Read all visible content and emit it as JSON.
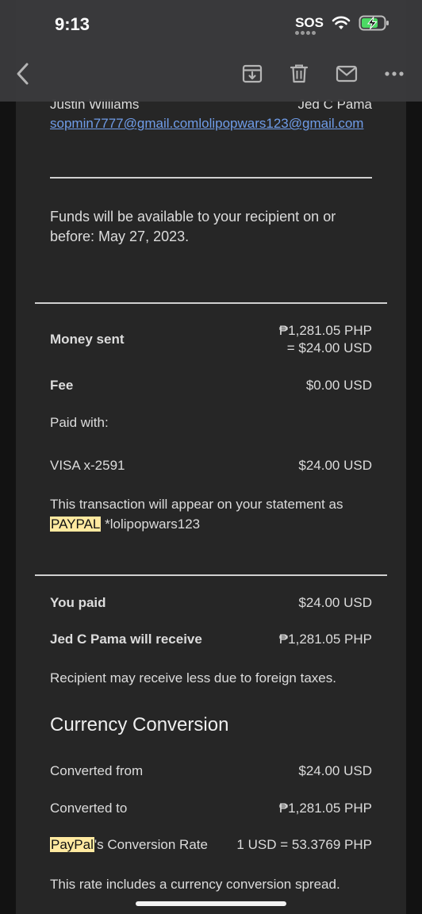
{
  "status": {
    "time": "9:13",
    "sos": "SOS"
  },
  "parties": {
    "sender_name": "Justin Williams",
    "recipient_name": "Jed C Pama",
    "emails": "sopmin7777@gmail.comlolipopwars123@gmail.com"
  },
  "availability_text": "Funds will be available to your recipient on or before: May 27, 2023.",
  "summary": {
    "money_sent_label": "Money sent",
    "money_sent_php": "₱1,281.05 PHP",
    "money_sent_usd": "= $24.00 USD",
    "fee_label": "Fee",
    "fee_value": "$0.00 USD",
    "paid_with_label": "Paid with:",
    "card_label": "VISA x-2591",
    "card_value": "$24.00 USD",
    "statement_prefix": "This transaction will appear on your statement as",
    "statement_highlight": "PAYPAL",
    "statement_suffix": " *lolipopwars123"
  },
  "payment": {
    "you_paid_label": "You paid",
    "you_paid_value": "$24.00 USD",
    "receive_label": "Jed C Pama will receive",
    "receive_value": "₱1,281.05 PHP",
    "note": "Recipient may receive less due to foreign taxes."
  },
  "conversion": {
    "heading": "Currency Conversion",
    "from_label": "Converted from",
    "from_value": "$24.00 USD",
    "to_label": "Converted to",
    "to_value": "₱1,281.05 PHP",
    "rate_highlight": "PayPal",
    "rate_label_rest": "'s Conversion Rate",
    "rate_value": "1 USD = 53.3769 PHP",
    "spread_note": "This rate includes a currency conversion spread."
  },
  "colors": {
    "highlight": "#ffe9a0",
    "link": "#6f9ce8",
    "background": "#262626",
    "toolbar": "#3a3a3c"
  },
  "icons": [
    "back-chevron-icon",
    "archive-icon",
    "trash-icon",
    "mail-icon",
    "more-icon",
    "wifi-icon",
    "battery-charging-icon"
  ]
}
